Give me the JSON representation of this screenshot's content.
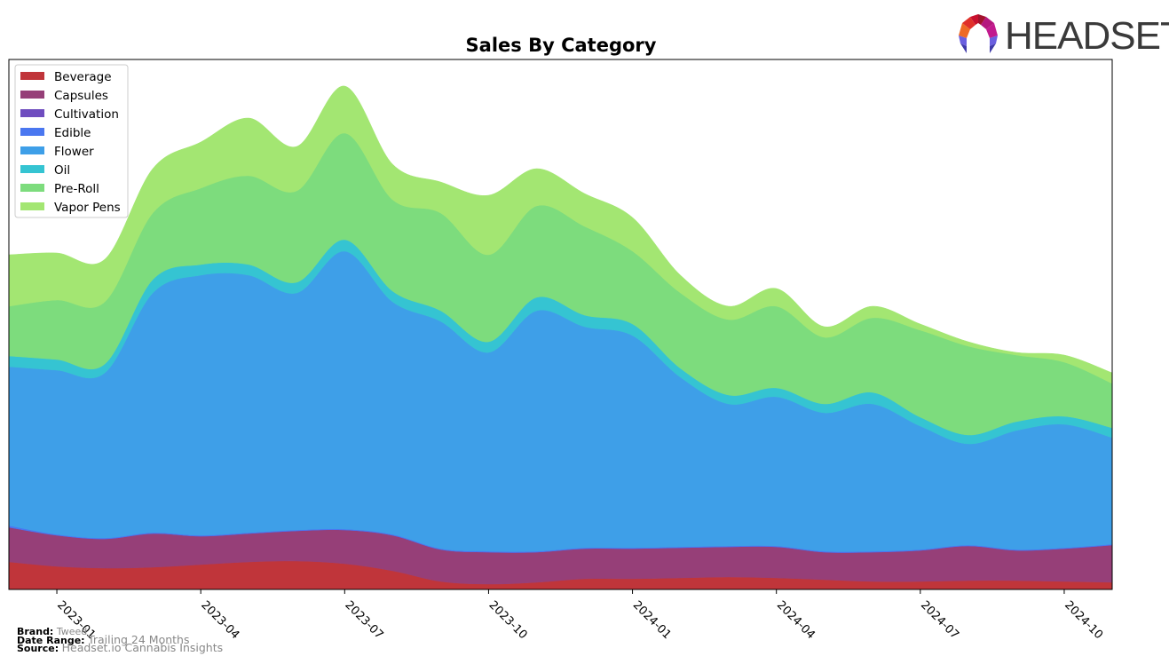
{
  "brand_logo": {
    "text": "HEADSET",
    "colors": [
      "#c8102e",
      "#e8572a",
      "#b5177e",
      "#5a4fcf",
      "#3f3aa8"
    ]
  },
  "footer": {
    "brand_label": "Brand:",
    "brand_value": "Tweed",
    "date_range_label": "Date Range:",
    "date_range_value": "Trailing 24 Months",
    "source_label": "Source:",
    "source_value": "Headset.io Cannabis Insights"
  },
  "chart_data": {
    "type": "area",
    "stacked": true,
    "smooth": true,
    "title": "Sales By Category",
    "xlabel": "",
    "ylabel": "",
    "y_axis_visible": false,
    "grid": false,
    "legend_position": "top-left",
    "x": [
      "2022-12",
      "2023-01",
      "2023-02",
      "2023-03",
      "2023-04",
      "2023-05",
      "2023-06",
      "2023-07",
      "2023-08",
      "2023-09",
      "2023-10",
      "2023-11",
      "2023-12",
      "2024-01",
      "2024-02",
      "2024-03",
      "2024-04",
      "2024-05",
      "2024-06",
      "2024-07",
      "2024-08",
      "2024-09",
      "2024-10",
      "2024-11"
    ],
    "x_ticks": [
      "2023-01",
      "2023-04",
      "2023-07",
      "2023-10",
      "2024-01",
      "2024-04",
      "2024-07",
      "2024-10"
    ],
    "ylim": [
      0,
      597
    ],
    "series": [
      {
        "name": "Beverage",
        "color": "#c0353a",
        "values": [
          31,
          26,
          24,
          25,
          28,
          31,
          32,
          29,
          21,
          9,
          6,
          8,
          12,
          12,
          13,
          14,
          13,
          11,
          9,
          9,
          10,
          10,
          9,
          8
        ]
      },
      {
        "name": "Capsules",
        "color": "#963f78",
        "values": [
          39,
          35,
          33,
          38,
          32,
          32,
          34,
          38,
          40,
          36,
          36,
          34,
          34,
          34,
          34,
          34,
          35,
          31,
          33,
          35,
          39,
          34,
          37,
          42
        ]
      },
      {
        "name": "Cultivation",
        "color": "#6f4dbf",
        "values": [
          0,
          0,
          0,
          0,
          0,
          0,
          0,
          0,
          0,
          0,
          0,
          0,
          0,
          0,
          0,
          0,
          0,
          0,
          0,
          0,
          0,
          0,
          0,
          0
        ]
      },
      {
        "name": "Edible",
        "color": "#4a77f0",
        "values": [
          2,
          1,
          1,
          1,
          1,
          1,
          1,
          1,
          1,
          1,
          1,
          1,
          1,
          1,
          1,
          1,
          1,
          1,
          1,
          1,
          1,
          1,
          1,
          1
        ]
      },
      {
        "name": "Flower",
        "color": "#3e9fe8",
        "values": [
          179,
          185,
          186,
          270,
          293,
          290,
          267,
          313,
          262,
          256,
          224,
          271,
          249,
          239,
          191,
          160,
          168,
          156,
          166,
          139,
          114,
          134,
          139,
          120
        ]
      },
      {
        "name": "Oil",
        "color": "#35c4d2",
        "values": [
          12,
          12,
          10,
          15,
          12,
          12,
          12,
          13,
          12,
          12,
          12,
          15,
          13,
          13,
          10,
          10,
          10,
          10,
          13,
          10,
          10,
          10,
          9,
          11
        ]
      },
      {
        "name": "Pre-Roll",
        "color": "#7ddc7d",
        "values": [
          56,
          67,
          70,
          75,
          86,
          100,
          103,
          120,
          103,
          110,
          98,
          103,
          100,
          82,
          85,
          85,
          92,
          75,
          84,
          98,
          100,
          75,
          61,
          50
        ]
      },
      {
        "name": "Vapor Pens",
        "color": "#a3e672",
        "values": [
          58,
          53,
          48,
          50,
          52,
          65,
          50,
          53,
          40,
          35,
          67,
          42,
          37,
          38,
          20,
          15,
          20,
          12,
          13,
          7,
          5,
          3,
          8,
          12
        ]
      }
    ]
  }
}
